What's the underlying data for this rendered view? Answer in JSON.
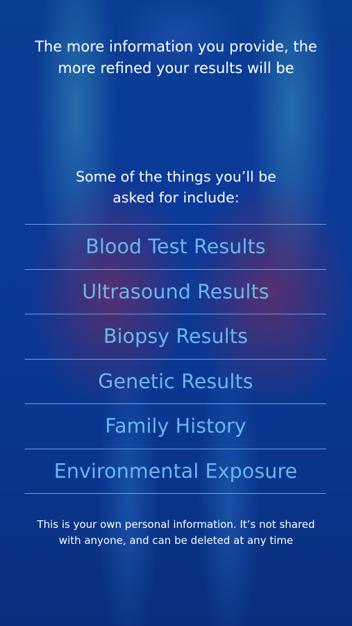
{
  "intro": {
    "text": "The more information you provide, the\nmore refined your results will be"
  },
  "subheading": {
    "text": "Some of the things you’ll be\nasked for include:"
  },
  "items": [
    {
      "label": "Blood Test Results"
    },
    {
      "label": "Ultrasound Results"
    },
    {
      "label": "Biopsy Results"
    },
    {
      "label": "Genetic Results"
    },
    {
      "label": "Family History"
    },
    {
      "label": "Environmental Exposure"
    }
  ],
  "footer": {
    "text": "This is your own personal information. It’s not shared\nwith anyone, and can be deleted at any time"
  },
  "colors": {
    "background": "#0b3a9a",
    "item_text": "#68b8ee",
    "divider": "#5fa6e2",
    "body_text": "#ffffff"
  }
}
